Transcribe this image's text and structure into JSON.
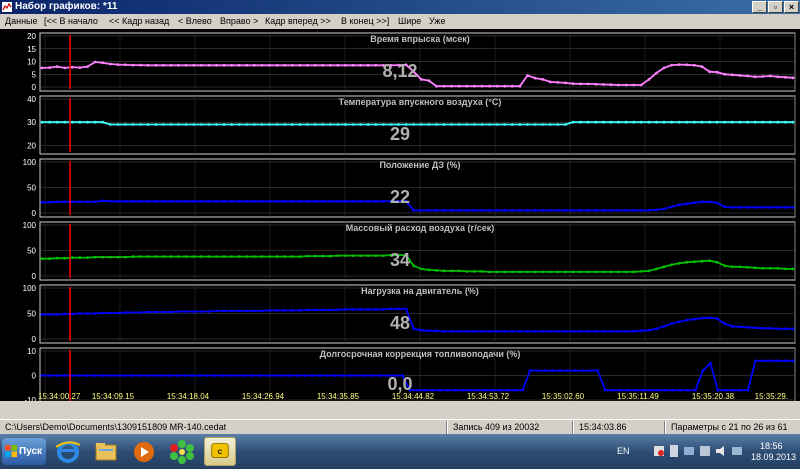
{
  "window": {
    "title": "Набор графиков: *11"
  },
  "menu": [
    "Данные",
    "[<< В начало",
    "<< Кадр назад",
    "< Влево",
    "Вправо >",
    "Кадр вперед >>",
    "В конец >>]",
    "Шире",
    "Уже"
  ],
  "time_axis": [
    "15:34:00.27",
    "15:34:09.15",
    "15:34:18.04",
    "15:34:26.94",
    "15:34:35.85",
    "15:34:44.82",
    "15:34:53.72",
    "15:35:02.60",
    "15:35:11.49",
    "15:35:20.38",
    "15:35:29."
  ],
  "status": {
    "file": "C:\\Users\\Demo\\Documents\\1309151809 MR-140.cedat",
    "record": "Запись 409 из 20032",
    "time": "15:34:03.86",
    "params": "Параметры с 21 по 26 из 61"
  },
  "taskbar": {
    "start": "Пуск",
    "lang": "EN",
    "clock_time": "18:56",
    "clock_date": "18.09.2013",
    "apps": [
      "ie-icon",
      "explorer-icon",
      "media-player-icon",
      "icq-icon",
      "app-icon"
    ]
  },
  "colors": {
    "pink": "#ff80ff",
    "cyan": "#40ffff",
    "blue": "#0000ff",
    "green": "#00c000",
    "cursor": "#ff0000"
  },
  "chart_data": [
    {
      "type": "line",
      "title": "Время впрыска  (мсек)",
      "current_value": "8,12",
      "yticks": [
        0,
        5,
        10,
        15,
        20
      ],
      "ylim": [
        0,
        20
      ],
      "color_key": "pink",
      "series": [
        {
          "values": [
            7.5,
            7.6,
            8.0,
            7.5,
            7.8,
            7.6,
            8.0,
            9.8,
            9.5,
            9.0,
            8.8,
            8.7,
            8.6,
            8.6,
            8.5,
            8.5,
            8.5,
            8.5,
            8.5,
            8.5,
            8.5,
            8.5,
            8.5,
            8.5,
            8.5,
            8.5,
            8.5,
            8.5,
            8.5,
            8.5,
            8.5,
            8.5,
            8.5,
            8.5,
            8.5,
            8.5,
            8.5,
            8.5,
            8.5,
            8.5,
            8.5,
            8.5,
            8.5,
            8.5,
            8.5,
            8.5,
            8.5,
            8.6,
            8.7,
            6.0,
            3.0,
            2.5,
            0.3,
            0.3,
            0.3,
            0.3,
            0.3,
            0.3,
            0.3,
            0.3,
            0.3,
            0.3,
            0.3,
            0.3,
            4.5,
            3.5,
            3.0,
            2.0,
            1.8,
            1.6,
            1.3,
            1.2,
            1.2,
            1.1,
            1.0,
            0.9,
            0.8,
            0.8,
            0.8,
            0.8,
            3.0,
            5.5,
            7.5,
            8.6,
            8.8,
            8.7,
            8.5,
            8.0,
            6.0,
            5.8,
            5.0,
            4.8,
            4.5,
            4.3,
            4.0,
            4.1,
            4.3,
            4.0,
            3.8,
            3.6
          ]
        }
      ]
    },
    {
      "type": "line",
      "title": "Температура впускного воздуха  (°С)",
      "current_value": "29",
      "yticks": [
        20,
        30,
        40
      ],
      "ylim": [
        18,
        40
      ],
      "color_key": "cyan",
      "series": [
        {
          "values": [
            30,
            30,
            30,
            30,
            30,
            30,
            30,
            30,
            30,
            29,
            29,
            29,
            29,
            29,
            29,
            29,
            29,
            29,
            29,
            29,
            29,
            29,
            29,
            29,
            29,
            29,
            29,
            29,
            29,
            29,
            29,
            29,
            29,
            29,
            29,
            29,
            29,
            29,
            29,
            29,
            29,
            29,
            29,
            29,
            29,
            29,
            29,
            29,
            29,
            29,
            29,
            29,
            29,
            29,
            29,
            29,
            29,
            29,
            29,
            29,
            29,
            29,
            29,
            29,
            29,
            29,
            29,
            29,
            29,
            29,
            30,
            30,
            30,
            30,
            30,
            30,
            30,
            30,
            30,
            30,
            30,
            30,
            30,
            30,
            30,
            30,
            30,
            30,
            30,
            30,
            30,
            30,
            30,
            30,
            30,
            30,
            30,
            30,
            30,
            30
          ]
        }
      ]
    },
    {
      "type": "line",
      "title": "Положение ДЗ  (%)",
      "current_value": "22",
      "yticks": [
        0,
        50,
        100
      ],
      "ylim": [
        0,
        100
      ],
      "color_key": "blue",
      "series": [
        {
          "values": [
            21,
            21,
            22,
            22,
            22,
            22,
            22,
            22,
            24,
            23,
            23,
            23,
            23,
            23,
            23,
            23,
            23,
            23,
            23,
            23,
            23,
            23,
            23,
            23,
            23,
            23,
            23,
            23,
            23,
            23,
            23,
            23,
            23,
            23,
            23,
            23,
            23,
            23,
            23,
            23,
            23,
            23,
            23,
            23,
            23,
            23,
            23,
            23,
            23,
            5,
            5,
            5,
            5,
            5,
            5,
            5,
            5,
            5,
            5,
            5,
            5,
            5,
            5,
            5,
            5,
            5,
            5,
            5,
            5,
            5,
            5,
            5,
            5,
            5,
            5,
            5,
            5,
            5,
            5,
            5,
            5,
            6,
            8,
            12,
            16,
            18,
            20,
            22,
            22,
            20,
            12,
            11,
            11,
            11,
            11,
            11,
            11,
            11,
            11,
            11
          ]
        }
      ]
    },
    {
      "type": "line",
      "title": "Массовый расход воздуха  (г/сек)",
      "current_value": "34",
      "yticks": [
        0,
        50,
        100
      ],
      "ylim": [
        0,
        100
      ],
      "color_key": "green",
      "series": [
        {
          "values": [
            34,
            34,
            35,
            35,
            36,
            36,
            36,
            37,
            37,
            37,
            37,
            37,
            38,
            38,
            38,
            38,
            38,
            38,
            38,
            38,
            38,
            38,
            38,
            38,
            38,
            38,
            38,
            38,
            38,
            38,
            38,
            38,
            38,
            38,
            38,
            39,
            39,
            39,
            39,
            40,
            40,
            40,
            40,
            40,
            40,
            40,
            41,
            41,
            41,
            20,
            14,
            12,
            11,
            10,
            10,
            10,
            9,
            9,
            9,
            8,
            8,
            8,
            8,
            8,
            8,
            8,
            8,
            8,
            8,
            8,
            8,
            8,
            8,
            8,
            8,
            8,
            8,
            8,
            8,
            9,
            10,
            14,
            18,
            22,
            25,
            27,
            28,
            29,
            30,
            27,
            20,
            18,
            18,
            17,
            16,
            15,
            15,
            15,
            14,
            14
          ]
        }
      ]
    },
    {
      "type": "line",
      "title": "Нагрузка на двигатель  (%)",
      "current_value": "48",
      "yticks": [
        0,
        50,
        100
      ],
      "ylim": [
        0,
        100
      ],
      "color_key": "blue",
      "series": [
        {
          "values": [
            48,
            48,
            48,
            49,
            49,
            50,
            50,
            50,
            51,
            51,
            51,
            52,
            52,
            52,
            53,
            53,
            53,
            53,
            54,
            54,
            54,
            54,
            54,
            55,
            55,
            55,
            55,
            55,
            55,
            55,
            56,
            56,
            56,
            56,
            56,
            57,
            57,
            57,
            57,
            57,
            58,
            58,
            58,
            58,
            58,
            58,
            59,
            59,
            59,
            20,
            17,
            16,
            16,
            15,
            15,
            15,
            15,
            15,
            15,
            15,
            15,
            15,
            15,
            15,
            15,
            15,
            15,
            15,
            15,
            15,
            15,
            15,
            15,
            15,
            15,
            15,
            15,
            15,
            15,
            16,
            17,
            20,
            25,
            30,
            34,
            37,
            39,
            41,
            42,
            40,
            30,
            25,
            24,
            23,
            22,
            21,
            21,
            20,
            20,
            20
          ]
        }
      ]
    },
    {
      "type": "line",
      "title": "Долгосрочная коррекция топливоподачи  (%)",
      "current_value": "0,0",
      "yticks": [
        -10,
        0,
        10
      ],
      "ylim": [
        -10,
        10
      ],
      "color_key": "blue",
      "series": [
        {
          "values": [
            0,
            0,
            0,
            0,
            0,
            0,
            0,
            0,
            0,
            0,
            0,
            0,
            0,
            0,
            0,
            0,
            0,
            0,
            0,
            0,
            0,
            0,
            0,
            0,
            0,
            0,
            0,
            0,
            0,
            0,
            0,
            0,
            0,
            0,
            0,
            0,
            0,
            0,
            0,
            0,
            0,
            0,
            0,
            0,
            0,
            0,
            0,
            0,
            0,
            -6,
            -6,
            -6,
            -6,
            -6,
            -6,
            -6,
            -6,
            -6,
            -6,
            -6,
            -6,
            -6,
            -6,
            -6,
            -6,
            2,
            2,
            2,
            2,
            2,
            2,
            2,
            2,
            2,
            2,
            -6,
            -6,
            -6,
            -6,
            -6,
            -6,
            -6,
            -6,
            -6,
            -6,
            -6,
            -6,
            -6,
            2,
            5,
            -6,
            -6,
            -6,
            -6,
            -6,
            6,
            6,
            6,
            6,
            6,
            6
          ]
        }
      ]
    }
  ]
}
